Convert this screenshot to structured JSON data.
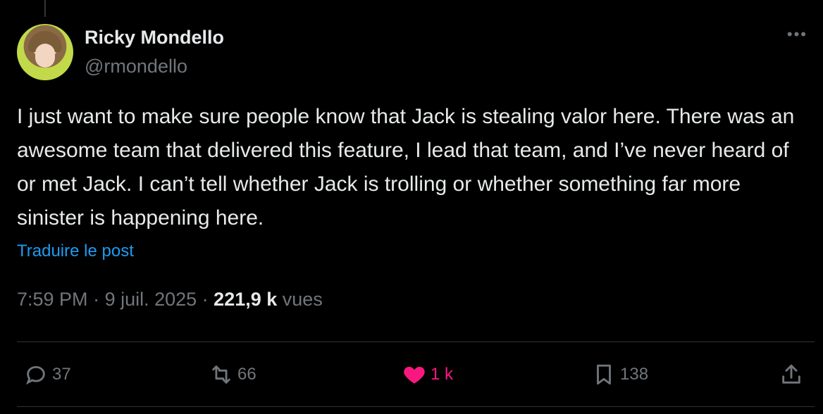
{
  "author": {
    "name": "Ricky Mondello",
    "handle": "@rmondello"
  },
  "tweet": {
    "text": "I just want to make sure people know that Jack is stealing valor here. There was an awesome team that delivered this feature, I lead that team, and I’ve never heard of or met Jack. I can’t tell whether Jack is trolling or whether something far more sinister is happening here.",
    "translate_label": "Traduire le post"
  },
  "meta": {
    "time": "7:59 PM",
    "date": "9 juil. 2025",
    "views_count": "221,9 k",
    "views_label": "vues",
    "separator": " · "
  },
  "actions": {
    "replies": "37",
    "reposts": "66",
    "likes": "1 k",
    "bookmarks": "138"
  },
  "colors": {
    "background": "#000000",
    "text": "#e7e9ea",
    "muted": "#71767b",
    "link": "#1d9bf0",
    "like": "#f91880"
  },
  "icons": {
    "more": "more-dots-icon",
    "reply": "reply-icon",
    "repost": "repost-icon",
    "like": "heart-icon",
    "bookmark": "bookmark-icon",
    "share": "share-icon"
  }
}
